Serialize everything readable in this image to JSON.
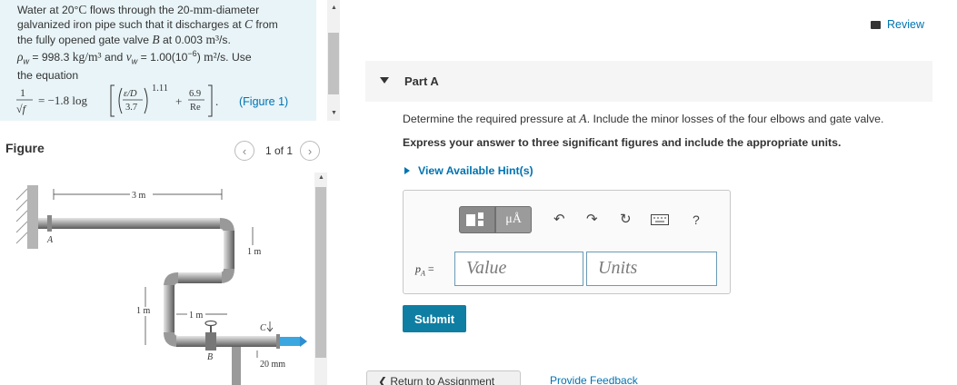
{
  "problem": {
    "line1_a": "Water at 20°",
    "line1_b": "C",
    "line1_c": " flows through the 20-",
    "line1_d": "mm",
    "line1_e": "-diameter",
    "line2_a": "galvanized iron pipe such that it discharges at ",
    "line2_b": "C",
    "line2_c": " from",
    "line3_a": "the fully opened gate valve ",
    "line3_b": "B",
    "line3_c": " at 0.003 ",
    "line3_d": "m³",
    "line3_e": "/s.",
    "line4_a": "ρ",
    "line4_b": "w",
    "line4_c": " = 998.3 ",
    "line4_d": "kg/m³",
    "line4_e": " and ",
    "line4_f": "ν",
    "line4_g": "w",
    "line4_h": " = 1.00(10",
    "line4_i": "−6",
    "line4_j": ") ",
    "line4_k": "m²",
    "line4_l": "/s. Use",
    "line5": "the equation",
    "eq_one": "1",
    "eq_sqrtf": "√f",
    "eq_equals": "= −1.8 log",
    "eq_eD": "ε/D",
    "eq_37": "3.7",
    "eq_exp": "1.11",
    "eq_plus": "+",
    "eq_69": "6.9",
    "eq_Re": "Re",
    "eq_dot": ".",
    "figure_link": "(Figure 1)"
  },
  "figure": {
    "label": "Figure",
    "pager": "1 of 1",
    "dim_3m": "3 m",
    "dim_1m_right": "1 m",
    "dim_1m_left": "1 m",
    "dim_1m_mid": "1 m",
    "dim_20mm": "20 mm",
    "label_A": "A",
    "label_B": "B",
    "label_C": "C"
  },
  "right": {
    "review": "Review",
    "part_title": "Part A",
    "question_a": "Determine the required pressure at ",
    "question_b": "A",
    "question_c": ". Include the minor losses of the four elbows and gate valve.",
    "instruction": "Express your answer to three significant figures and include the appropriate units.",
    "hints": "View Available Hint(s)",
    "answer_label_p": "p",
    "answer_label_sub": "A",
    "answer_label_eq": " =",
    "value_placeholder": "Value",
    "units_placeholder": "Units",
    "unit_tool": "μÅ",
    "help_tool": "?",
    "submit": "Submit",
    "return": "❮ Return to Assignment",
    "feedback": "Provide Feedback"
  }
}
